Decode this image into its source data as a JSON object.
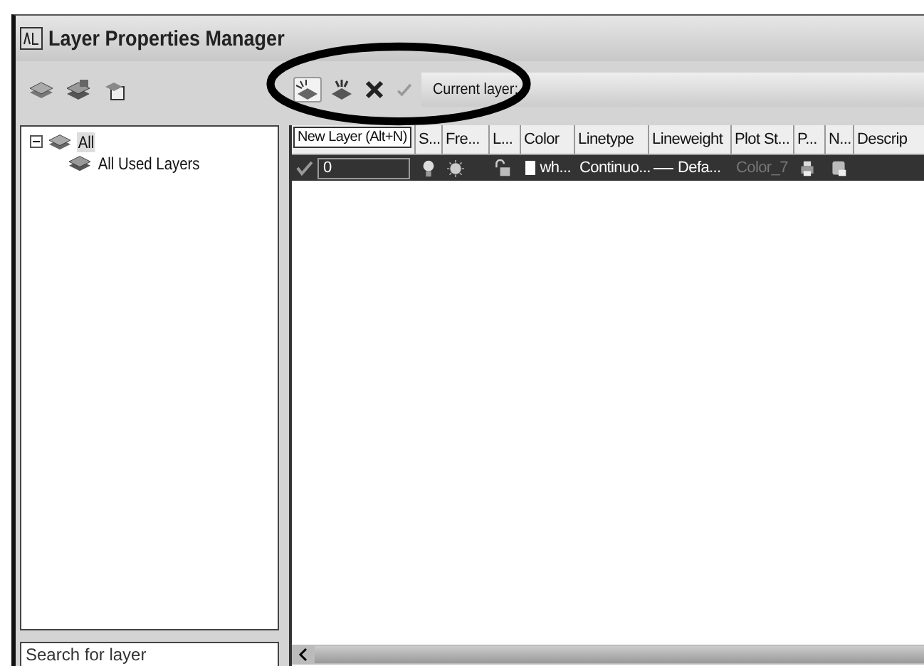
{
  "window": {
    "title": "Layer Properties Manager"
  },
  "toolbar": {
    "current_layer_label": "Current layer:"
  },
  "tree": [
    {
      "label": "All",
      "expanded": true,
      "selected": true,
      "children": [
        {
          "label": "All Used Layers",
          "selected": false
        }
      ]
    }
  ],
  "tooltip": "New Layer (Alt+N)",
  "columns": [
    "",
    "S...",
    "Fre...",
    "L...",
    "Color",
    "Linetype",
    "Lineweight",
    "Plot St...",
    "P...",
    "N...",
    "Descrip"
  ],
  "rows": [
    {
      "current": true,
      "selected": true,
      "name": "0",
      "color_name": "wh...",
      "color": "#ffffff",
      "linetype": "Continuo...",
      "lineweight": "Defa...",
      "plot_style": "Color_7"
    }
  ],
  "search": {
    "placeholder": "Search for layer"
  }
}
